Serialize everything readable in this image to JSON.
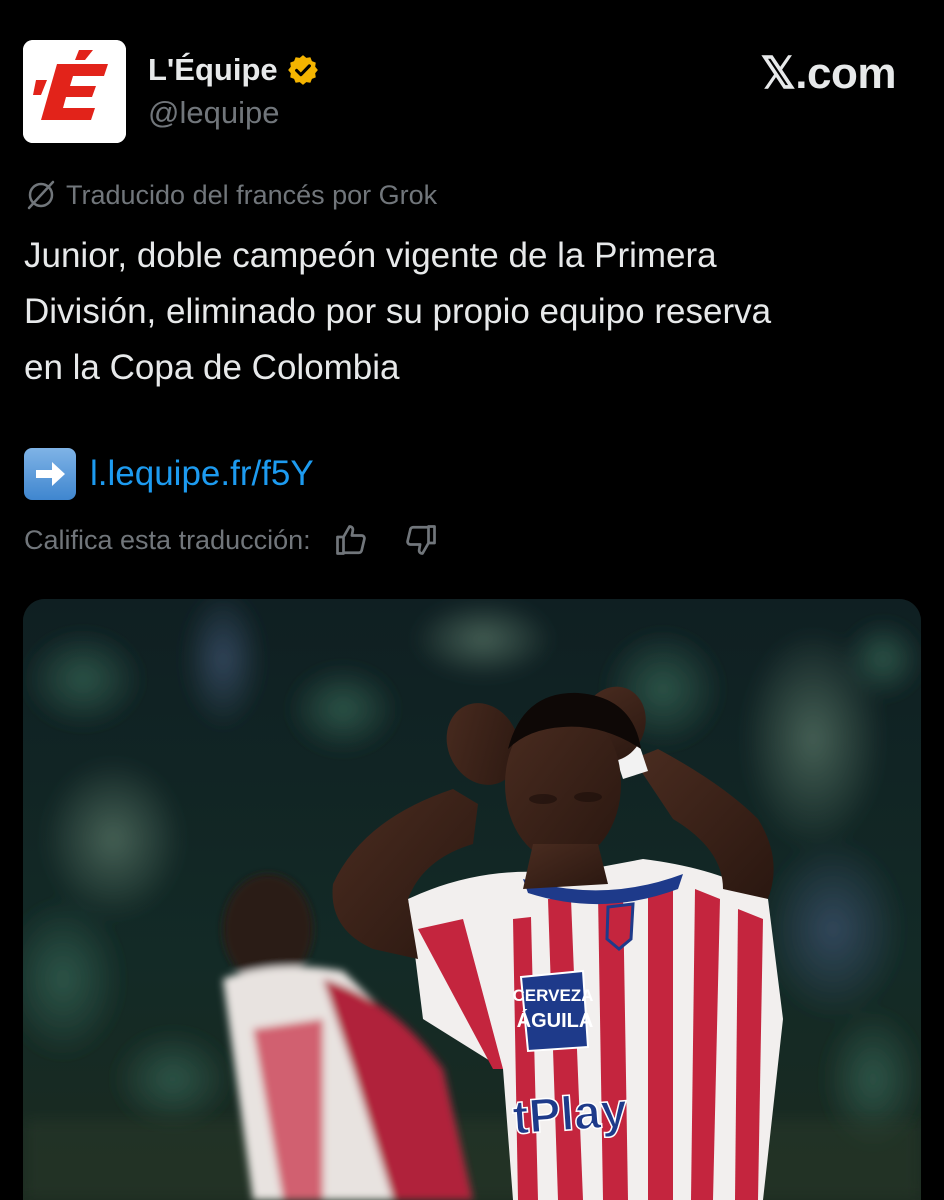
{
  "account": {
    "avatar_letter": "E",
    "avatar_brand_color": "#e2231a",
    "display_name": "L'Équipe",
    "handle": "@lequipe",
    "verified_icon": "verified-gold-badge"
  },
  "source_label": "𝕏.com",
  "translation_notice": "Traducido del francés por Grok",
  "tweet": {
    "text_lines": [
      "Junior, doble campeón vigente de la Primera",
      "División, eliminado por su propio equipo reserva",
      "en la Copa de Colombia"
    ],
    "link_emoji": "right-arrow-emoji",
    "link_text": "l.lequipe.fr/f5Y"
  },
  "rate_translation": {
    "label": "Califica esta traducción:",
    "up_icon": "thumbs-up-icon",
    "down_icon": "thumbs-down-icon"
  },
  "media": {
    "jersey_sponsor_1": "CERVEZA\nÁGUILA",
    "jersey_sponsor_2": "tPlay"
  },
  "colors": {
    "background": "#000000",
    "text_primary": "#e7e9ea",
    "text_secondary": "#71767b",
    "link": "#1d9bf0",
    "verified": "#f4b400"
  }
}
